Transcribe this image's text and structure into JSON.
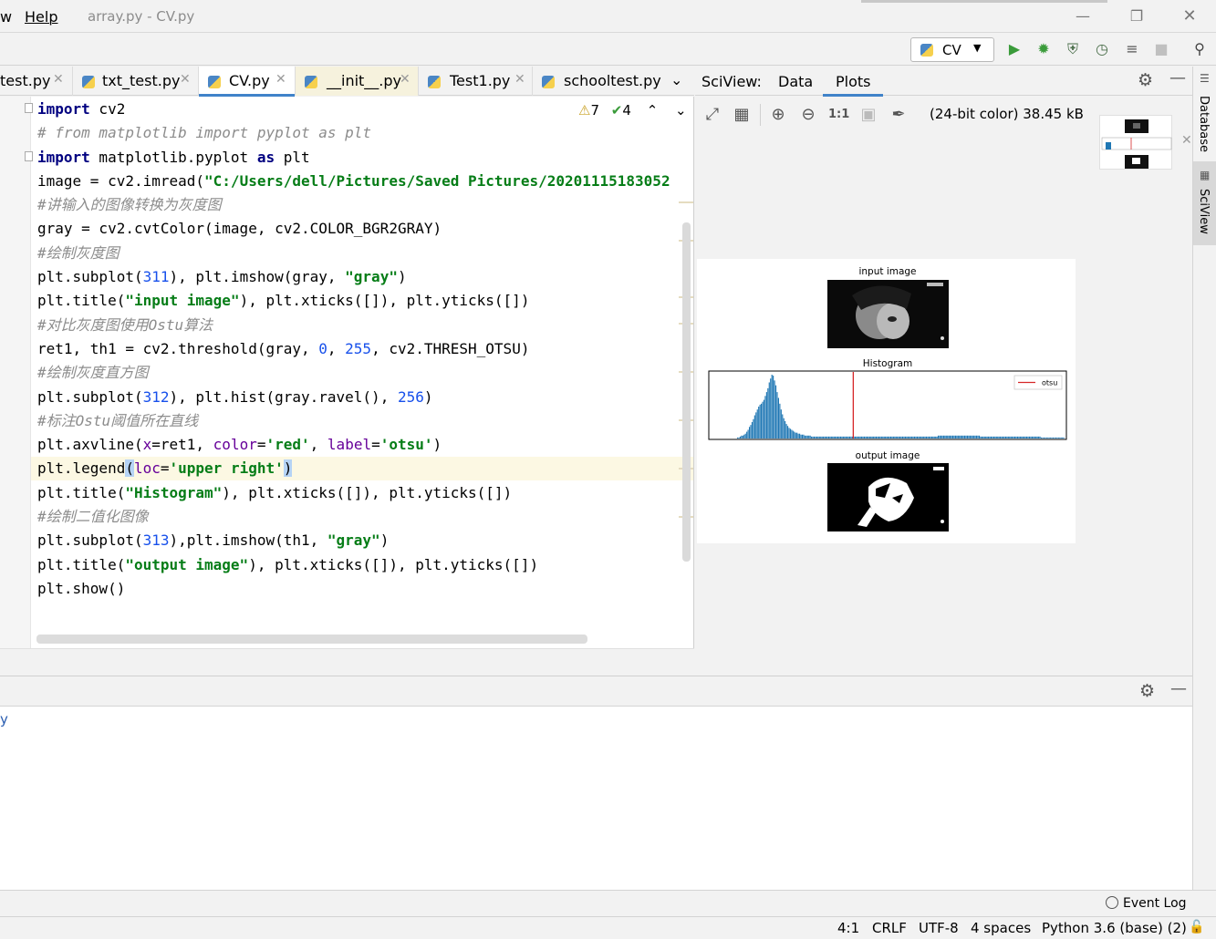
{
  "menubar": {
    "items": [
      "w",
      "Help"
    ],
    "window_title": "array.py - CV.py"
  },
  "toolbar": {
    "run_config": "CV"
  },
  "tabs": [
    {
      "label": "test.py"
    },
    {
      "label": "txt_test.py"
    },
    {
      "label": "CV.py"
    },
    {
      "label": "__init__.py"
    },
    {
      "label": "Test1.py"
    },
    {
      "label": "schooltest.py"
    }
  ],
  "editor": {
    "inspection": {
      "warnings": "7",
      "weak_warnings": "4"
    },
    "lines": [
      [
        "import",
        " cv2"
      ],
      [
        "# from matplotlib import pyplot as plt"
      ],
      [
        "import",
        " matplotlib.pyplot ",
        "as",
        " plt"
      ],
      [
        "image = cv2.imread(",
        "\"C:/Users/dell/Pictures/Saved Pictures/20201115183052"
      ],
      [
        "#讲输入的图像转换为灰度图"
      ],
      [
        "gray = cv2.cvtColor(image, cv2.COLOR_BGR2GRAY)"
      ],
      [
        "#绘制灰度图"
      ],
      [
        "plt.subplot(",
        "311",
        "), plt.imshow(gray, ",
        "\"gray\"",
        ")"
      ],
      [
        "plt.title(",
        "\"input image\"",
        "), plt.xticks([]), plt.yticks([])"
      ],
      [
        "#对比灰度图使用Ostu算法"
      ],
      [
        "ret1, th1 = cv2.threshold(gray, ",
        "0",
        ", ",
        "255",
        ", cv2.THRESH_OTSU)"
      ],
      [
        "#绘制灰度直方图"
      ],
      [
        "plt.subplot(",
        "312",
        "), plt.hist(gray.ravel(), ",
        "256",
        ")"
      ],
      [
        "#标注Ostu阈值所在直线"
      ],
      [
        "plt.axvline(",
        "x",
        "=ret1, ",
        "color",
        "=",
        "'red'",
        ", ",
        "label",
        "=",
        "'otsu'",
        ")"
      ],
      [
        "plt.legend",
        "(",
        "loc",
        "=",
        "'upper right'",
        ")"
      ],
      [
        "plt.title(",
        "\"Histogram\"",
        "), plt.xticks([]), plt.yticks([])"
      ],
      [
        "#绘制二值化图像"
      ],
      [
        "plt.subplot(",
        "313",
        "),plt.imshow(th1, ",
        "\"gray\"",
        ")"
      ],
      [
        "plt.title(",
        "\"output image\"",
        "), plt.xticks([]), plt.yticks([])"
      ],
      [
        "plt.show()"
      ]
    ]
  },
  "sciview": {
    "title": "SciView:",
    "tabs": [
      "Data",
      "Plots"
    ],
    "info": "(24-bit color) 38.45 kB",
    "stripe_label": "SciView",
    "database_label": "Database"
  },
  "chart_data": [
    {
      "type": "image",
      "title": "input image"
    },
    {
      "type": "bar",
      "title": "Histogram",
      "legend": [
        "otsu"
      ],
      "legend_position": "upper right",
      "threshold_color": "#d62728",
      "bar_color": "#1f77b4",
      "threshold_bin": 108,
      "bins": 256,
      "values": [
        0,
        0,
        0,
        0,
        0,
        0,
        0,
        0,
        0,
        0,
        0,
        0,
        0,
        0,
        0,
        0,
        0,
        0,
        0,
        0,
        1,
        1,
        2,
        3,
        3,
        4,
        5,
        7,
        9,
        12,
        14,
        17,
        20,
        24,
        27,
        30,
        33,
        35,
        36,
        38,
        40,
        44,
        48,
        52,
        58,
        62,
        66,
        65,
        60,
        55,
        48,
        42,
        36,
        30,
        25,
        21,
        18,
        15,
        13,
        11,
        10,
        9,
        8,
        7,
        6,
        6,
        5,
        5,
        4,
        4,
        4,
        3,
        3,
        3,
        3,
        3,
        2,
        2,
        2,
        2,
        2,
        2,
        2,
        2,
        2,
        2,
        2,
        2,
        2,
        2,
        2,
        2,
        2,
        2,
        2,
        2,
        2,
        2,
        2,
        2,
        2,
        2,
        2,
        2,
        2,
        2,
        2,
        2,
        2,
        2,
        2,
        2,
        2,
        2,
        2,
        2,
        2,
        2,
        2,
        2,
        2,
        2,
        2,
        2,
        2,
        2,
        2,
        2,
        2,
        2,
        2,
        2,
        2,
        2,
        2,
        2,
        2,
        2,
        2,
        2,
        2,
        2,
        2,
        2,
        2,
        2,
        2,
        2,
        2,
        2,
        2,
        2,
        2,
        2,
        2,
        2,
        2,
        2,
        2,
        2,
        2,
        2,
        2,
        2,
        2,
        2,
        2,
        2,
        2,
        2,
        2,
        2,
        3,
        3,
        3,
        3,
        3,
        3,
        3,
        3,
        3,
        3,
        3,
        3,
        3,
        3,
        3,
        3,
        3,
        3,
        3,
        3,
        3,
        3,
        3,
        3,
        3,
        3,
        3,
        3,
        3,
        3,
        3,
        3,
        2,
        2,
        2,
        2,
        2,
        2,
        2,
        2,
        2,
        2,
        2,
        2,
        2,
        2,
        2,
        2,
        2,
        2,
        2,
        2,
        2,
        2,
        2,
        2,
        2,
        2,
        2,
        2,
        2,
        2,
        2,
        2,
        2,
        2,
        2,
        2,
        2,
        2,
        2,
        2,
        2,
        2,
        2,
        2,
        2,
        2,
        1,
        1,
        1,
        1,
        1,
        1,
        1,
        1,
        1,
        1,
        1,
        1,
        1,
        1,
        1,
        1,
        1,
        1
      ]
    },
    {
      "type": "image",
      "title": "output image"
    }
  ],
  "bottom_panel": {
    "text": "y"
  },
  "statusbar": {
    "event_log": "Event Log",
    "position": "4:1",
    "line_sep": "CRLF",
    "encoding": "UTF-8",
    "indent": "4 spaces",
    "interpreter": "Python 3.6 (base) (2)"
  }
}
